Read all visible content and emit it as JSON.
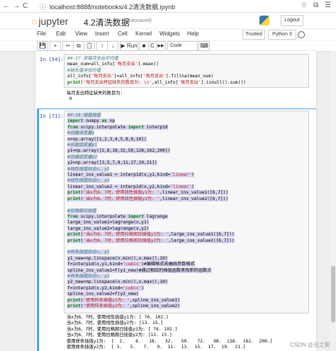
{
  "browser": {
    "url": "localhost:8888/notebooks/4.2清洗数据.ipynb",
    "nav_back": "←",
    "nav_forward": "→",
    "nav_reload": "C",
    "lock": "ⓘ",
    "right_icons": "☆ ⧉ ☰"
  },
  "header": {
    "logo_text": "jupyter",
    "notebook_title": "4.2清洗数据",
    "autosave_status": "(autosaved)",
    "logout_label": "Logout"
  },
  "menu": {
    "items": [
      "File",
      "Edit",
      "View",
      "Insert",
      "Cell",
      "Kernel",
      "Widgets",
      "Help"
    ],
    "trusted_label": "Trusted",
    "kernel_label": "Python 3"
  },
  "toolbar": {
    "buttons": [
      "💾",
      "+",
      "✂",
      "⧉",
      "📋",
      "↑",
      "↓"
    ],
    "run_label": "▶ Run",
    "stop": "■",
    "restart": "C",
    "fast_forward": "▶▶",
    "cell_type": "Code",
    "keyboard": "⌨"
  },
  "cells": [
    {
      "prompt": "In [54]:",
      "code_lines": [
        "#4-17 求每月支出平均值",
        "mean_num=all_info['每月支出'].mean()",
        "#缺失值寻找均值",
        "all_info['每月支出']=all_info['每月支出'].fillna(mean_num)",
        "print('每月支出特征缺失的数目为: \\n',all_info['每月支出'].isnull().sum())"
      ],
      "output_lines": [
        "每月支出特征缺失的数目为:",
        " 0"
      ]
    },
    {
      "prompt": "In [71]:",
      "code_lines": [
        "#4-18 插值插值",
        "import numpy as np",
        "from scipy.interpolate import interp1d",
        "#创建自变量x",
        "x=np.array([1,2,3,4,5,8,9,10])",
        "#创建因变量y1",
        "y1=np.array([2,8,18,32,50,128,162,200])",
        "#创建因变量y2",
        "y2=np.array([3,5,7,9,11,17,19,21])",
        "#线性插值拟合x, y1",
        "linear_ins_value1 = interp1d(x,y1,kind='linear')",
        "#线性插值拟合x, y2",
        "linear_ins_value2 = interp1d(x,y2,kind='linear')",
        "print('当x为6、7时，使用线性插值y1为: ',linear_ins_value1([6,7]))",
        "print('当x为6、7时，使用线性插值y2为: ',linear_ins_value2([6,7]))",
        "",
        "#拉格朗日插值",
        "from scipy.interpolate import lagrange",
        "large_ins_value1=lagrange(x,y1)",
        "large_ins_value2=lagrange(x,y2)",
        "print('当x为6、7时，使用拉格朗日插值y1为: ',large_ins_value1([6,7]))",
        "print('当x为6、7时，使用拉格朗日插值y2为: ',large_ins_value2([6,7]))",
        "",
        "#样条插值拟合x, y1",
        "y1_new=np.linspace(x.min(),x.max(),10)",
        "f=interp1d(x,y1,kind='cubic')#编辑格式去曲线参数格式",
        "spline_ins_value1=f(y1_new)#通过相应的插值函数来找新的函数点",
        "#样条插值拟合x, y2",
        "y2_new=np.linspace(x.min(),x.max(),10)",
        "f=interp1d(x,y2,kind='cubic')",
        "spline_ins_value2=f(y2_new)",
        "print('使用样条插值y1为: ',spline_ins_value1)",
        "print('使用样条插值y2为: ',spline_ins_value2)"
      ],
      "output_lines": [
        "当x为6、7时，使用线性插值y1为: [ 76. 102.]",
        "当x为6、7时，使用线性插值y2为: [13. 15.]",
        "当x为6、7时，使用拉格朗日插值y1为: [ 76. 102.]",
        "当x为6、7时，使用拉格朗日插值y2为: [13. 15.]",
        "使用样条插值y1为:  [  2.    8.   18.   32.   50.   72.   98.  128.  162.  200.]",
        "使用样条插值y2为:  [ 3.   5.   7.   9.  11.  13.  15.  17.  19.  21.]"
      ]
    }
  ],
  "watermark": "CSDN @光之影",
  "colors": {
    "selected_border": "#42a5f5",
    "highlight": "#d7d4f0",
    "prompt": "#303f9f",
    "jupyter_orange": "#f37726"
  }
}
